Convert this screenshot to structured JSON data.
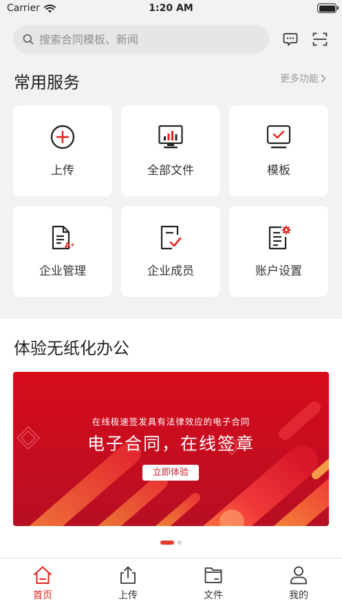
{
  "status_bar": {
    "carrier": "Carrier",
    "time": "1:20 AM"
  },
  "search": {
    "placeholder": "搜索合同模板、新闻"
  },
  "services": {
    "title": "常用服务",
    "more": "更多功能",
    "items": [
      {
        "label": "上传",
        "icon": "plus-circle-icon"
      },
      {
        "label": "全部文件",
        "icon": "monitor-chart-icon"
      },
      {
        "label": "模板",
        "icon": "monitor-check-icon"
      },
      {
        "label": "企业管理",
        "icon": "document-grade-icon"
      },
      {
        "label": "企业成员",
        "icon": "document-check-icon"
      },
      {
        "label": "账户设置",
        "icon": "document-gear-icon"
      }
    ]
  },
  "promo": {
    "title": "体验无纸化办公",
    "banner_subtitle": "在线极速签发具有法律效应的电子合同",
    "banner_title": "电子合同，在线签章",
    "banner_button": "立即体验"
  },
  "carousel": {
    "count": 2,
    "active": 0
  },
  "tabs": [
    {
      "label": "首页",
      "icon": "home-icon",
      "active": true
    },
    {
      "label": "上传",
      "icon": "upload-icon",
      "active": false
    },
    {
      "label": "文件",
      "icon": "folder-icon",
      "active": false
    },
    {
      "label": "我的",
      "icon": "user-icon",
      "active": false
    }
  ],
  "colors": {
    "accent": "#e0231e",
    "banner": "#d3121f"
  }
}
